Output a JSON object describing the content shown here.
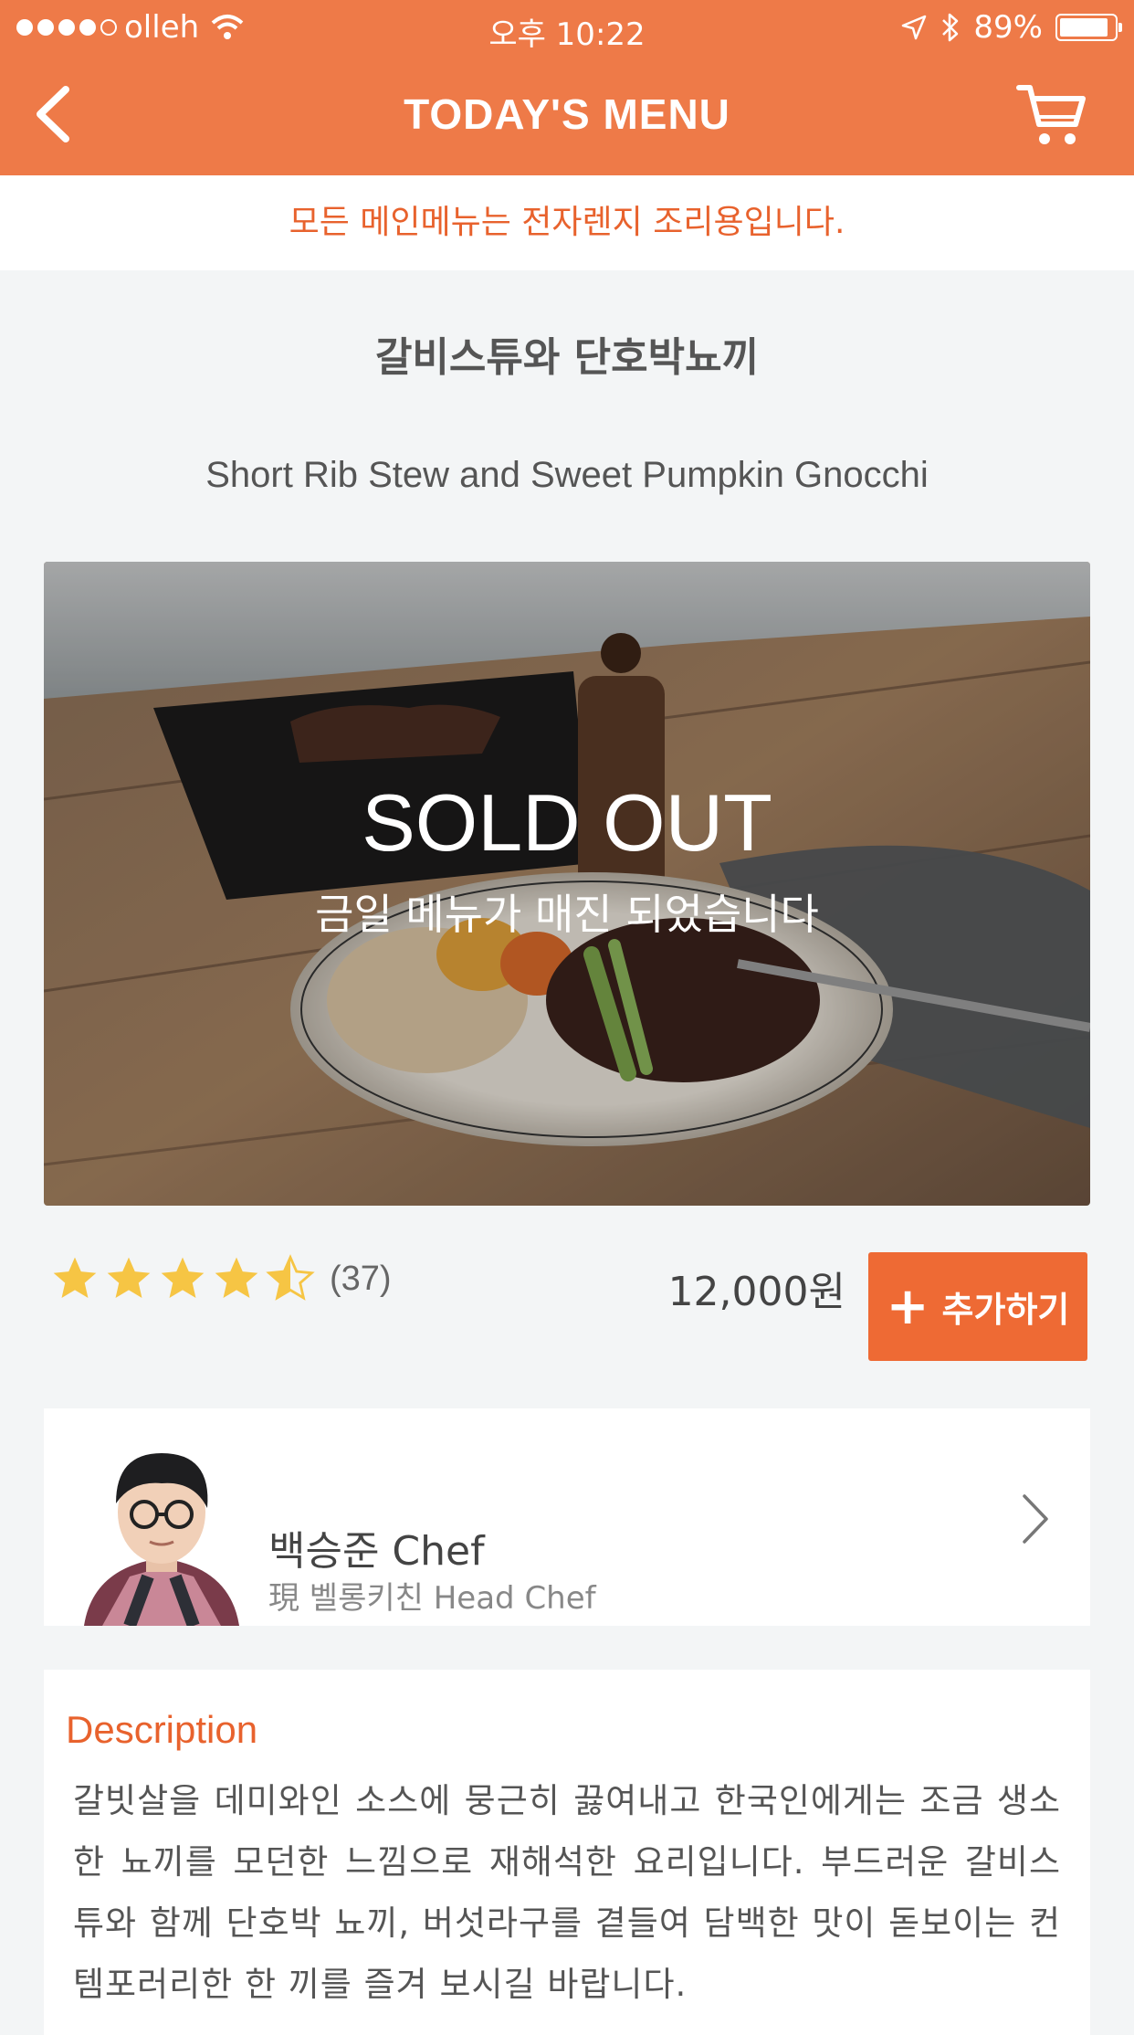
{
  "status_bar": {
    "carrier": "olleh",
    "time": "오후 10:22",
    "battery": "89%",
    "battery_level": 0.89,
    "signal_bars_filled": 4,
    "signal_bars_total": 5
  },
  "nav": {
    "title": "TODAY'S MENU",
    "back_icon": "chevron-left-icon",
    "cart_icon": "cart-icon"
  },
  "notice": "모든 메인메뉴는 전자렌지 조리용입니다.",
  "menu": {
    "title_ko": "갈비스튜와 단호박뇨끼",
    "title_en": "Short Rib Stew and Sweet Pumpkin Gnocchi",
    "sold_out": "SOLD OUT",
    "sold_out_sub": "금일 메뉴가 매진 되었습니다",
    "rating": 4.5,
    "rating_max": 5,
    "rating_count": "(37)",
    "price": "12,000원",
    "add_label": "추가하기"
  },
  "chef": {
    "name": "백승준 Chef",
    "role": "現 벨롱키친 Head Chef"
  },
  "description": {
    "title": "Description",
    "body": "갈빗살을 데미와인 소스에 뭉근히 끓여내고 한국인에게는 조금 생소한 뇨끼를 모던한 느낌으로 재해석한 요리입니다. 부드러운 갈비스튜와 함께 단호박 뇨끼, 버섯라구를 곁들여 담백한 맛이 돋보이는 컨템포러리한 한 끼를 즐겨 보시길 바랍니다."
  },
  "colors": {
    "brand": "#ee7a48",
    "accent": "#e8622d",
    "star": "#f6c544"
  }
}
